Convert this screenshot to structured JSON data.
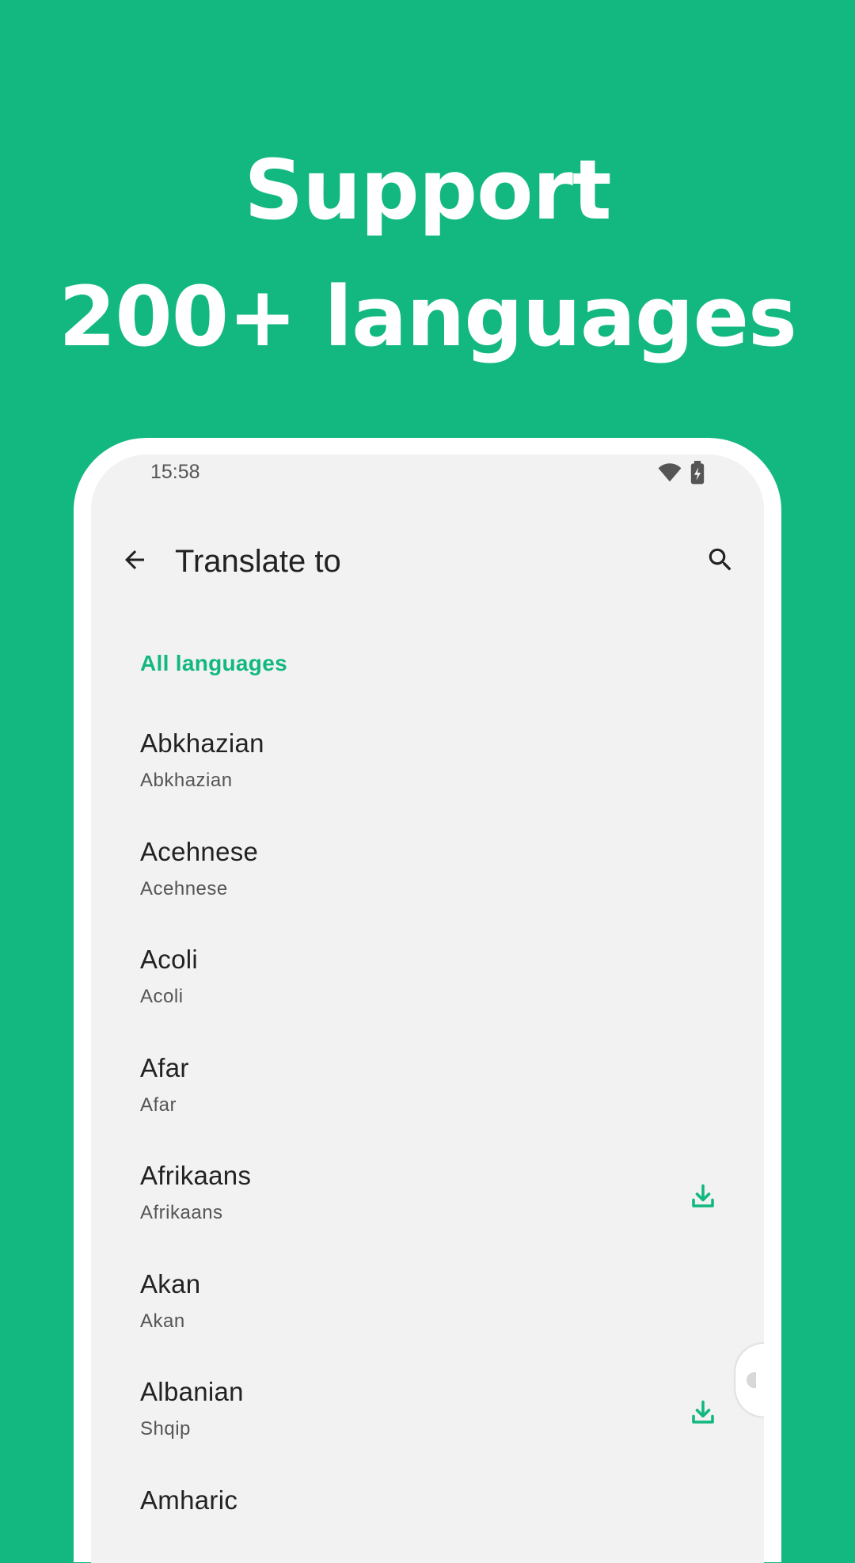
{
  "headline": {
    "line1": "Support",
    "line2": "200+ languages"
  },
  "status_bar": {
    "time": "15:58",
    "icons": [
      "wifi-icon",
      "battery-charging-icon"
    ]
  },
  "app_bar": {
    "back_icon": "arrow-back-icon",
    "title": "Translate to",
    "search_icon": "search-icon"
  },
  "section": {
    "header": "All languages"
  },
  "languages": [
    {
      "name": "Abkhazian",
      "native": "Abkhazian",
      "downloadable": false
    },
    {
      "name": "Acehnese",
      "native": "Acehnese",
      "downloadable": false
    },
    {
      "name": "Acoli",
      "native": "Acoli",
      "downloadable": false
    },
    {
      "name": "Afar",
      "native": "Afar",
      "downloadable": false
    },
    {
      "name": "Afrikaans",
      "native": "Afrikaans",
      "downloadable": true
    },
    {
      "name": "Akan",
      "native": "Akan",
      "downloadable": false
    },
    {
      "name": "Albanian",
      "native": "Shqip",
      "downloadable": true
    },
    {
      "name": "Amharic",
      "native": "",
      "downloadable": false
    }
  ],
  "colors": {
    "background": "#12b880",
    "accent": "#12b880",
    "screen": "#f2f2f2",
    "text_primary": "#222222",
    "text_secondary": "#555555"
  }
}
